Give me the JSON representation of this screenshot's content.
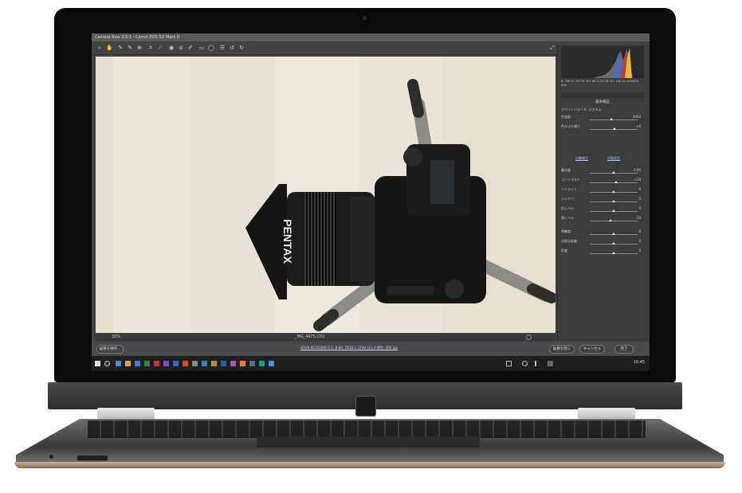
{
  "app": {
    "window_title": "Camera Raw 9.5.1 - Canon EOS 5D Mark II",
    "zoom_level": "30%",
    "filename": "_MG_4975.CR2",
    "workflow_link": "sRGB IEC61966-2.1; 8 bit; 5616 x 3744 (21.0 MP); 300 ppi"
  },
  "panel": {
    "histogram_readout": "R: 208  G: 207  B: 201   f/8  1/125 秒  ISO 100  24-105@50 mm",
    "section_title": "基本補正",
    "white_balance_label": "ホワイトバランス: カスタム",
    "auto_label": "自動補正",
    "default_label": "初期設定",
    "sliders": [
      {
        "label": "色温度",
        "value": "4450",
        "pos": 0.45
      },
      {
        "label": "色かぶり補正",
        "value": "+6",
        "pos": 0.52
      },
      {
        "label": "露光量",
        "value": "0.00",
        "pos": 0.5
      },
      {
        "label": "コントラスト",
        "value": "+10",
        "pos": 0.55
      },
      {
        "label": "ハイライト",
        "value": "0",
        "pos": 0.5
      },
      {
        "label": "シャドウ",
        "value": "0",
        "pos": 0.5
      },
      {
        "label": "白レベル",
        "value": "0",
        "pos": 0.5
      },
      {
        "label": "黒レベル",
        "value": "-18",
        "pos": 0.44
      },
      {
        "label": "明瞭度",
        "value": "0",
        "pos": 0.5
      },
      {
        "label": "自然な彩度",
        "value": "0",
        "pos": 0.5
      },
      {
        "label": "彩度",
        "value": "0",
        "pos": 0.5
      }
    ]
  },
  "footer": {
    "save_label": "画像を保存...",
    "open_label": "画像を開く",
    "cancel_label": "キャンセル",
    "done_label": "完了"
  },
  "taskbar": {
    "clock": "16:45"
  },
  "photo": {
    "lens_brand": "PENTAX"
  },
  "colors": {
    "accent_blue": "#4a90d9",
    "panel_bg": "#3d3d3d",
    "wood": "#ebe3d6"
  }
}
